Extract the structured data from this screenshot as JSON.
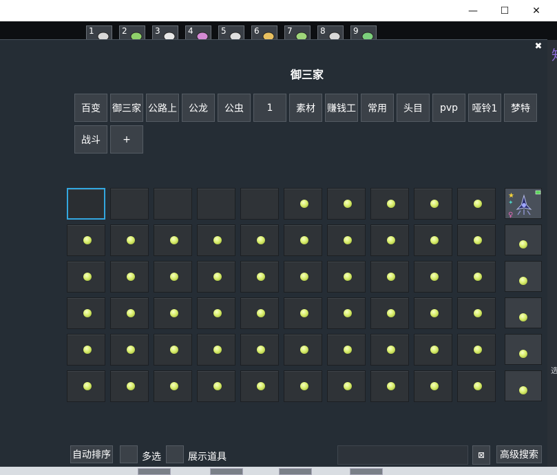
{
  "window": {
    "minimize_glyph": "—",
    "maximize_glyph": "☐",
    "close_glyph": "✕"
  },
  "hotbar": {
    "slots": [
      {
        "num": "1",
        "icon": "pokemon-icon"
      },
      {
        "num": "2",
        "icon": "pokemon-icon"
      },
      {
        "num": "3",
        "icon": "pokemon-icon"
      },
      {
        "num": "4",
        "icon": "pokemon-icon"
      },
      {
        "num": "5",
        "icon": "pokemon-icon"
      },
      {
        "num": "6",
        "icon": "pokemon-icon"
      },
      {
        "num": "7",
        "icon": "pokemon-icon"
      },
      {
        "num": "8",
        "icon": "pokemon-icon"
      },
      {
        "num": "9",
        "icon": "pokemon-icon"
      }
    ]
  },
  "side": {
    "char_top": "知",
    "char_mid": "选"
  },
  "dialog": {
    "close_label": "✖",
    "title": "御三家",
    "tabs_row1": [
      "百变",
      "御三家",
      "公路上",
      "公龙",
      "公虫",
      "1",
      "素材",
      "赚钱工",
      "常用",
      "头目",
      "pvp",
      "哑铃1",
      "梦特"
    ],
    "tabs_row2": [
      "战斗",
      "+"
    ],
    "grid": {
      "rows": 6,
      "cols": 10,
      "selected_index": 0,
      "empty_indices": [
        0,
        1,
        2,
        3,
        4
      ]
    },
    "side_column": {
      "portrait": "pokemon-portrait",
      "gem_count": 5
    },
    "bottom": {
      "auto_sort": "自动排序",
      "multi_select": "多选",
      "show_items": "展示道具",
      "search_value": "",
      "clear_glyph": "⊠",
      "advanced_search": "高级搜索"
    }
  },
  "colors": {
    "selected_border": "#33a7e0",
    "gem": "#d9ee6c",
    "panel_bg": "#252d35"
  }
}
